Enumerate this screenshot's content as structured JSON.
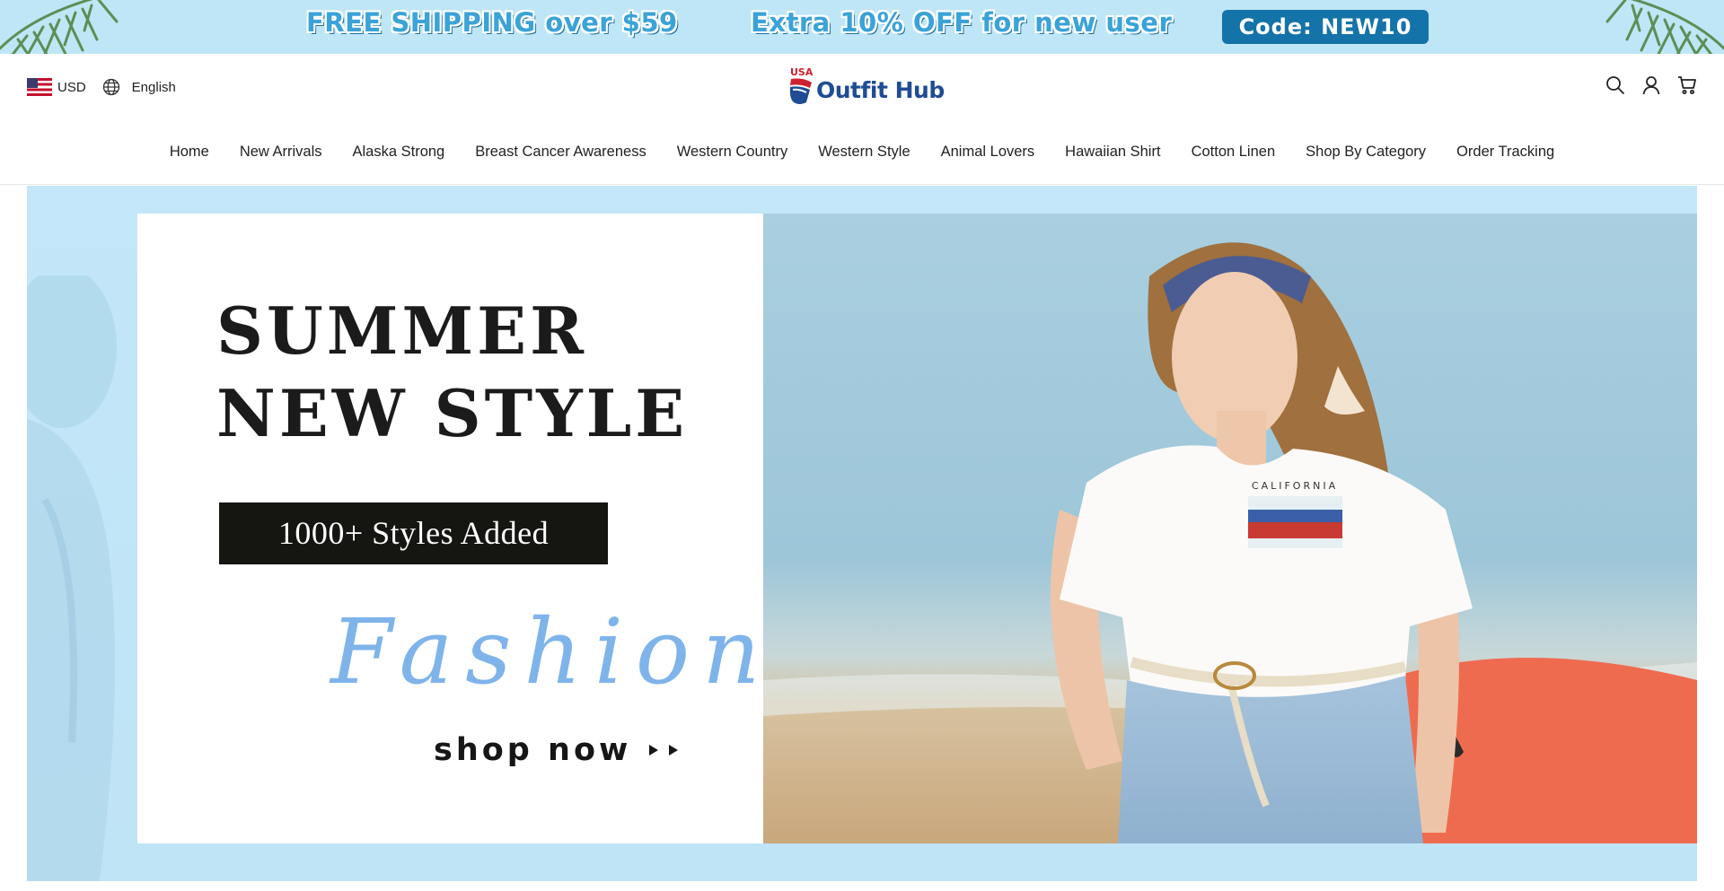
{
  "promo": {
    "shipping_text": "FREE SHIPPING over $59",
    "discount_text": "Extra 10% OFF for new user",
    "code_text": "Code: NEW10"
  },
  "header": {
    "currency": "USD",
    "language": "English",
    "logo": {
      "small": "USA",
      "name": "Outfit Hub"
    },
    "icons": [
      "search-icon",
      "account-icon",
      "cart-icon"
    ]
  },
  "nav": {
    "items": [
      "Home",
      "New Arrivals",
      "Alaska Strong",
      "Breast Cancer Awareness",
      "Western Country",
      "Western Style",
      "Animal Lovers",
      "Hawaiian Shirt",
      "Cotton Linen",
      "Shop By Category",
      "Order Tracking"
    ]
  },
  "hero": {
    "title_line1": "SUMMER",
    "title_line2": "NEW STYLE",
    "badge": "1000+ Styles Added",
    "script_word": "Fashion",
    "cta": "shop now",
    "tshirt_print": "CALIFORNIA"
  },
  "colors": {
    "promo_bg": "#bfe6f7",
    "code_badge": "#1473a8",
    "logo_blue": "#1f4c94",
    "logo_red": "#d0212e",
    "hero_bg": "#c3e7f8",
    "fashion_script": "#7fb4ea",
    "board_orange": "#ef6b4f"
  }
}
